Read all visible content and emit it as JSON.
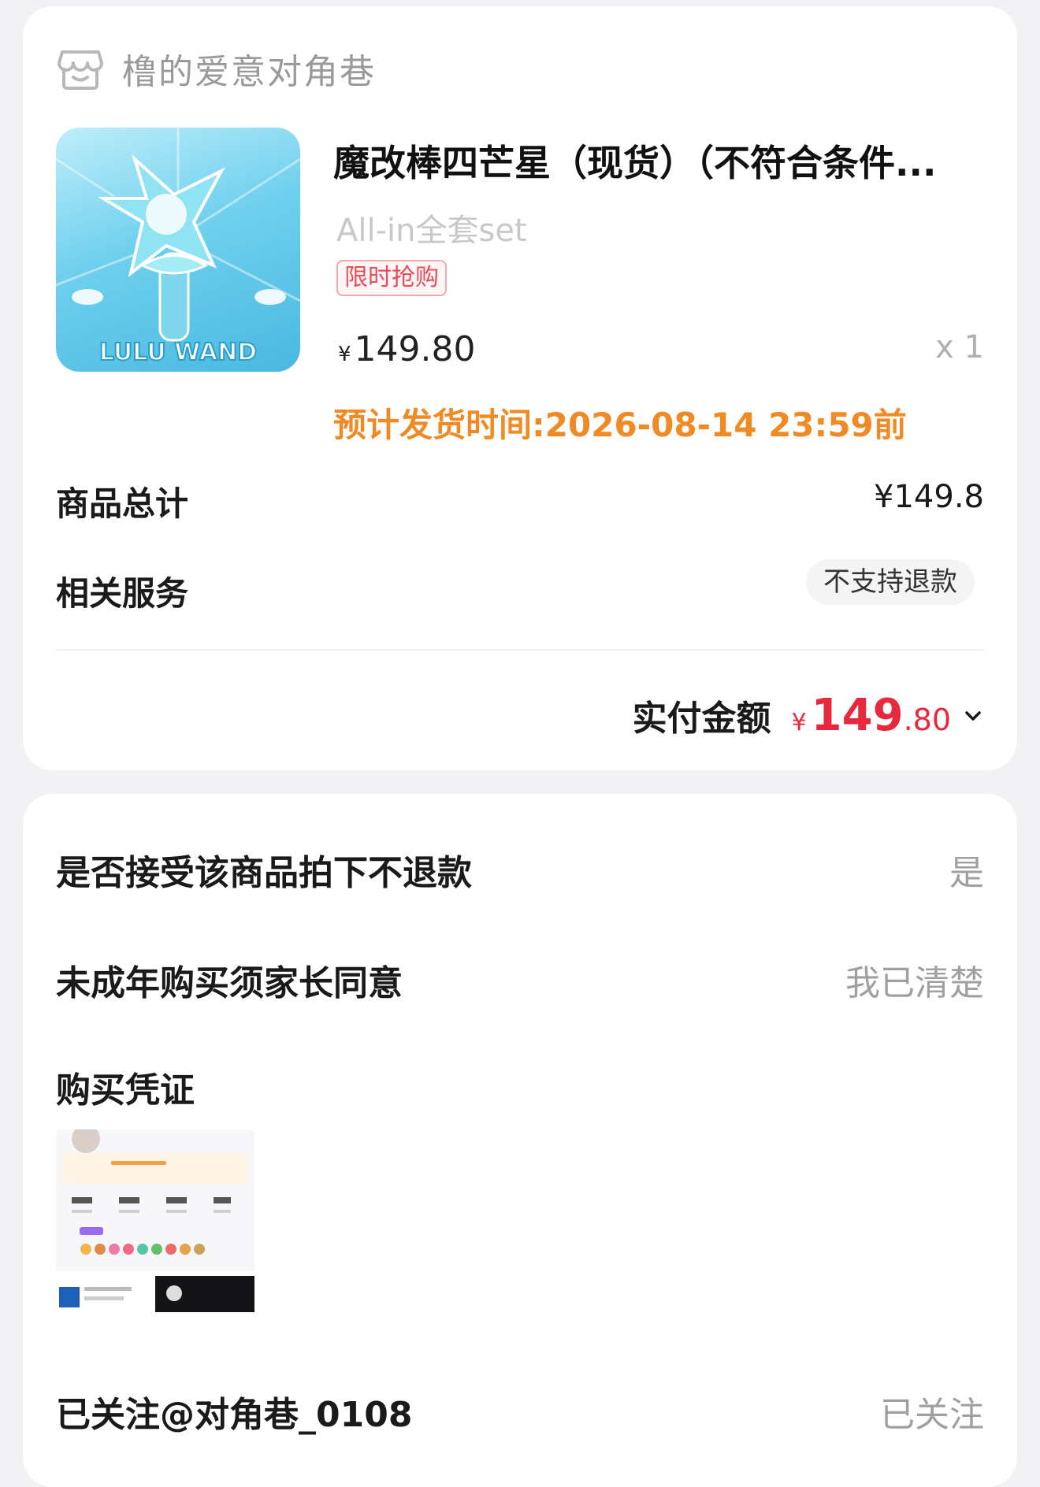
{
  "store": {
    "name": "橹的爱意对角巷",
    "icon": "store-icon"
  },
  "product": {
    "title": "魔改棒四芒星（现货）（不符合条件...",
    "sku": "All-in全套set",
    "tag": "限时抢购",
    "price_symbol": "¥",
    "price": "149.80",
    "quantity": "x 1",
    "ship_time": "预计发货时间:2026-08-14 23:59前",
    "thumb_text": "LULU WAND"
  },
  "summary": {
    "total_label": "商品总计",
    "total_value": "¥149.8",
    "service_label": "相关服务",
    "service_value": "不支持退款",
    "paid_label": "实付金额",
    "paid_symbol": "¥",
    "paid_int": "149",
    "paid_dec": ".80"
  },
  "extra": {
    "q1_label": "是否接受该商品拍下不退款",
    "q1_value": "是",
    "q2_label": "未成年购买须家长同意",
    "q2_value": "我已清楚",
    "proof_label": "购买凭证",
    "follow_label": "已关注@对角巷_0108",
    "follow_value": "已关注"
  },
  "colors": {
    "accent_red": "#e8283c",
    "ship_orange": "#f08a24",
    "muted": "#a0a0a0"
  }
}
